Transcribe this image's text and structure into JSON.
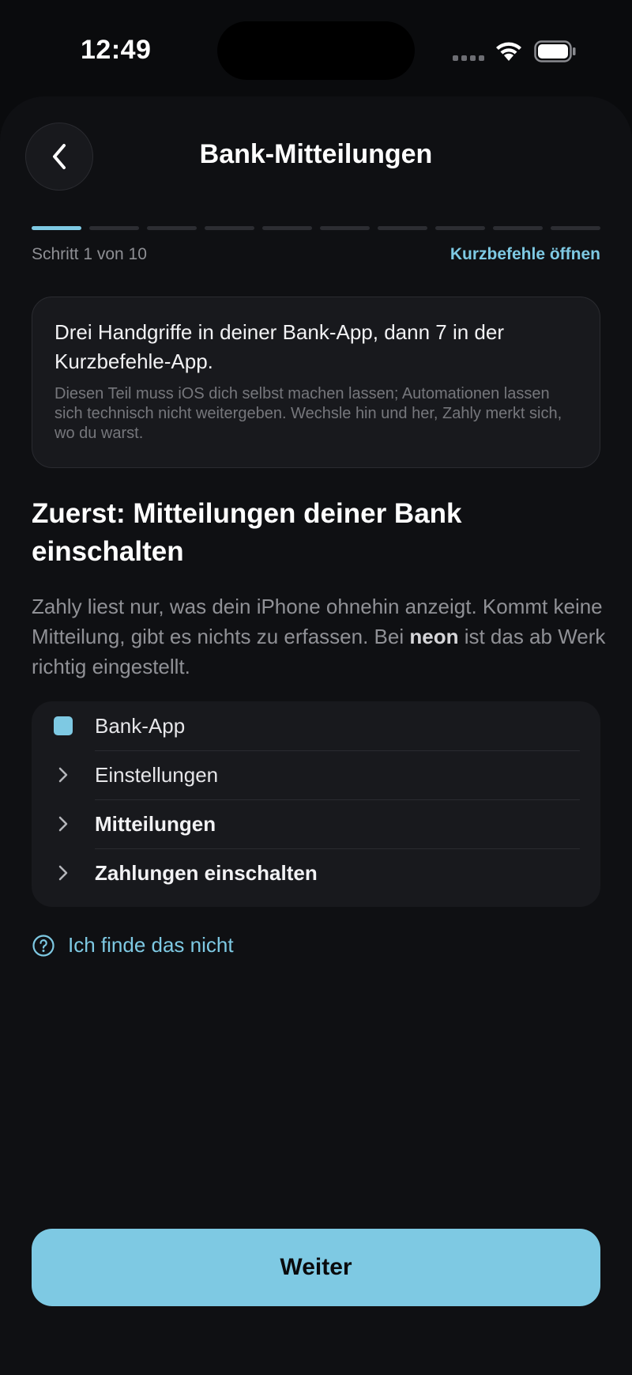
{
  "status_bar": {
    "time": "12:49"
  },
  "header": {
    "title": "Bank-Mitteilungen"
  },
  "progress": {
    "current_step": 1,
    "total_steps": 10,
    "label": "Schritt 1 von 10",
    "link": "Kurzbefehle öffnen"
  },
  "info_card": {
    "title": "Drei Handgriffe in deiner Bank-App, dann 7 in der Kurzbefehle-App.",
    "subtitle": "Diesen Teil muss iOS dich selbst machen lassen; Automationen lassen sich technisch nicht weitergeben. Wechsle hin und her, Zahly merkt sich, wo du warst."
  },
  "section": {
    "heading": "Zuerst: Mitteilungen deiner Bank einschalten",
    "desc_before": "Zahly liest nur, was dein iPhone ohnehin anzeigt. Kommt keine Mitteilung, gibt es nichts zu erfassen. Bei ",
    "desc_bold": "neon",
    "desc_after": " ist das ab Werk richtig eingestellt."
  },
  "steps": [
    {
      "label": "Bank-App",
      "icon": "app-square-icon"
    },
    {
      "label": "Einstellungen",
      "icon": "chevron-right-icon"
    },
    {
      "label": "Mitteilungen",
      "icon": "chevron-right-icon"
    },
    {
      "label": "Zahlungen einschalten",
      "icon": "chevron-right-icon"
    }
  ],
  "help": {
    "label": "Ich finde das nicht",
    "icon": "question-circle-icon"
  },
  "footer": {
    "primary_label": "Weiter"
  },
  "colors": {
    "accent": "#7ec9e3",
    "background": "#0a0b0d",
    "card": "#18191d"
  }
}
